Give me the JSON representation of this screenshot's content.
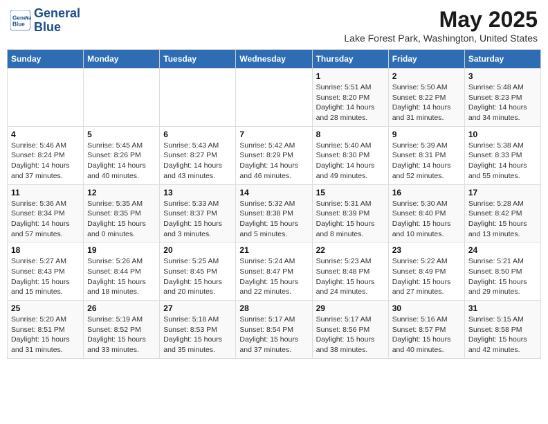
{
  "header": {
    "logo_line1": "General",
    "logo_line2": "Blue",
    "main_title": "May 2025",
    "sub_title": "Lake Forest Park, Washington, United States"
  },
  "days_of_week": [
    "Sunday",
    "Monday",
    "Tuesday",
    "Wednesday",
    "Thursday",
    "Friday",
    "Saturday"
  ],
  "weeks": [
    [
      {
        "day": "",
        "info": ""
      },
      {
        "day": "",
        "info": ""
      },
      {
        "day": "",
        "info": ""
      },
      {
        "day": "",
        "info": ""
      },
      {
        "day": "1",
        "info": "Sunrise: 5:51 AM\nSunset: 8:20 PM\nDaylight: 14 hours\nand 28 minutes."
      },
      {
        "day": "2",
        "info": "Sunrise: 5:50 AM\nSunset: 8:22 PM\nDaylight: 14 hours\nand 31 minutes."
      },
      {
        "day": "3",
        "info": "Sunrise: 5:48 AM\nSunset: 8:23 PM\nDaylight: 14 hours\nand 34 minutes."
      }
    ],
    [
      {
        "day": "4",
        "info": "Sunrise: 5:46 AM\nSunset: 8:24 PM\nDaylight: 14 hours\nand 37 minutes."
      },
      {
        "day": "5",
        "info": "Sunrise: 5:45 AM\nSunset: 8:26 PM\nDaylight: 14 hours\nand 40 minutes."
      },
      {
        "day": "6",
        "info": "Sunrise: 5:43 AM\nSunset: 8:27 PM\nDaylight: 14 hours\nand 43 minutes."
      },
      {
        "day": "7",
        "info": "Sunrise: 5:42 AM\nSunset: 8:29 PM\nDaylight: 14 hours\nand 46 minutes."
      },
      {
        "day": "8",
        "info": "Sunrise: 5:40 AM\nSunset: 8:30 PM\nDaylight: 14 hours\nand 49 minutes."
      },
      {
        "day": "9",
        "info": "Sunrise: 5:39 AM\nSunset: 8:31 PM\nDaylight: 14 hours\nand 52 minutes."
      },
      {
        "day": "10",
        "info": "Sunrise: 5:38 AM\nSunset: 8:33 PM\nDaylight: 14 hours\nand 55 minutes."
      }
    ],
    [
      {
        "day": "11",
        "info": "Sunrise: 5:36 AM\nSunset: 8:34 PM\nDaylight: 14 hours\nand 57 minutes."
      },
      {
        "day": "12",
        "info": "Sunrise: 5:35 AM\nSunset: 8:35 PM\nDaylight: 15 hours\nand 0 minutes."
      },
      {
        "day": "13",
        "info": "Sunrise: 5:33 AM\nSunset: 8:37 PM\nDaylight: 15 hours\nand 3 minutes."
      },
      {
        "day": "14",
        "info": "Sunrise: 5:32 AM\nSunset: 8:38 PM\nDaylight: 15 hours\nand 5 minutes."
      },
      {
        "day": "15",
        "info": "Sunrise: 5:31 AM\nSunset: 8:39 PM\nDaylight: 15 hours\nand 8 minutes."
      },
      {
        "day": "16",
        "info": "Sunrise: 5:30 AM\nSunset: 8:40 PM\nDaylight: 15 hours\nand 10 minutes."
      },
      {
        "day": "17",
        "info": "Sunrise: 5:28 AM\nSunset: 8:42 PM\nDaylight: 15 hours\nand 13 minutes."
      }
    ],
    [
      {
        "day": "18",
        "info": "Sunrise: 5:27 AM\nSunset: 8:43 PM\nDaylight: 15 hours\nand 15 minutes."
      },
      {
        "day": "19",
        "info": "Sunrise: 5:26 AM\nSunset: 8:44 PM\nDaylight: 15 hours\nand 18 minutes."
      },
      {
        "day": "20",
        "info": "Sunrise: 5:25 AM\nSunset: 8:45 PM\nDaylight: 15 hours\nand 20 minutes."
      },
      {
        "day": "21",
        "info": "Sunrise: 5:24 AM\nSunset: 8:47 PM\nDaylight: 15 hours\nand 22 minutes."
      },
      {
        "day": "22",
        "info": "Sunrise: 5:23 AM\nSunset: 8:48 PM\nDaylight: 15 hours\nand 24 minutes."
      },
      {
        "day": "23",
        "info": "Sunrise: 5:22 AM\nSunset: 8:49 PM\nDaylight: 15 hours\nand 27 minutes."
      },
      {
        "day": "24",
        "info": "Sunrise: 5:21 AM\nSunset: 8:50 PM\nDaylight: 15 hours\nand 29 minutes."
      }
    ],
    [
      {
        "day": "25",
        "info": "Sunrise: 5:20 AM\nSunset: 8:51 PM\nDaylight: 15 hours\nand 31 minutes."
      },
      {
        "day": "26",
        "info": "Sunrise: 5:19 AM\nSunset: 8:52 PM\nDaylight: 15 hours\nand 33 minutes."
      },
      {
        "day": "27",
        "info": "Sunrise: 5:18 AM\nSunset: 8:53 PM\nDaylight: 15 hours\nand 35 minutes."
      },
      {
        "day": "28",
        "info": "Sunrise: 5:17 AM\nSunset: 8:54 PM\nDaylight: 15 hours\nand 37 minutes."
      },
      {
        "day": "29",
        "info": "Sunrise: 5:17 AM\nSunset: 8:56 PM\nDaylight: 15 hours\nand 38 minutes."
      },
      {
        "day": "30",
        "info": "Sunrise: 5:16 AM\nSunset: 8:57 PM\nDaylight: 15 hours\nand 40 minutes."
      },
      {
        "day": "31",
        "info": "Sunrise: 5:15 AM\nSunset: 8:58 PM\nDaylight: 15 hours\nand 42 minutes."
      }
    ]
  ]
}
